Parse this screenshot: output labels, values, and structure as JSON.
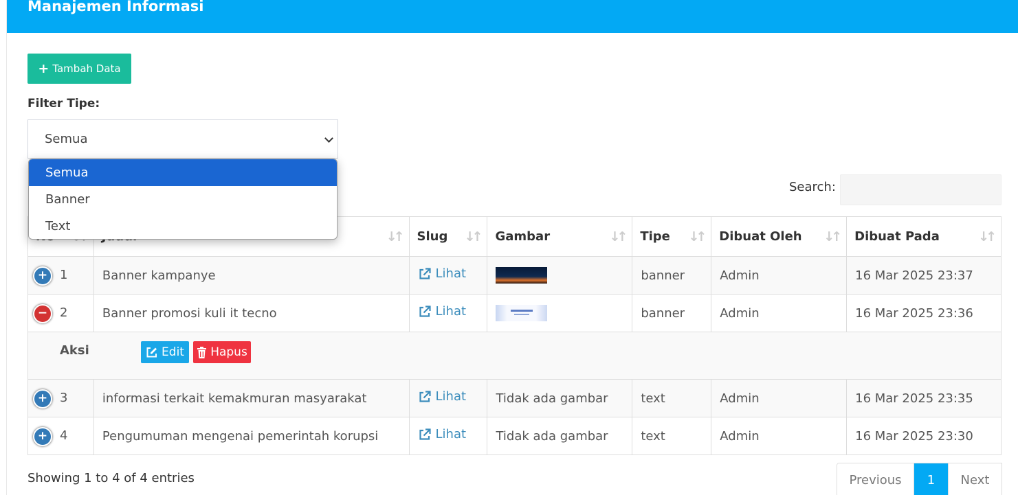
{
  "header": {
    "title": "Manajemen Informasi"
  },
  "toolbar": {
    "add_label": "Tambah Data",
    "add_icon": "plus-icon"
  },
  "filter": {
    "label": "Filter Tipe:",
    "selected": "Semua",
    "options": [
      "Semua",
      "Banner",
      "Text"
    ]
  },
  "search": {
    "label": "Search:",
    "value": ""
  },
  "table": {
    "columns": [
      "No",
      "Judul",
      "Slug",
      "Gambar",
      "Tipe",
      "Dibuat Oleh",
      "Dibuat Pada"
    ],
    "rows": [
      {
        "no": "1",
        "judul": "Banner kampanye",
        "slug": "Lihat",
        "gambar": "",
        "tipe": "banner",
        "dibuat_oleh": "Admin",
        "dibuat_pada": "16 Mar 2025 23:37"
      },
      {
        "no": "2",
        "judul": "Banner promosi kuli it tecno",
        "slug": "Lihat",
        "gambar": "",
        "tipe": "banner",
        "dibuat_oleh": "Admin",
        "dibuat_pada": "16 Mar 2025 23:36"
      },
      {
        "no": "3",
        "judul": "informasi terkait kemakmuran masyarakat",
        "slug": "Lihat",
        "gambar": "Tidak ada gambar",
        "tipe": "text",
        "dibuat_oleh": "Admin",
        "dibuat_pada": "16 Mar 2025 23:35"
      },
      {
        "no": "4",
        "judul": "Pengumuman mengenai pemerintah korupsi",
        "slug": "Lihat",
        "gambar": "Tidak ada gambar",
        "tipe": "text",
        "dibuat_oleh": "Admin",
        "dibuat_pada": "16 Mar 2025 23:30"
      }
    ],
    "child_row": {
      "label": "Aksi",
      "edit_label": "Edit",
      "delete_label": "Hapus"
    }
  },
  "info": {
    "text": "Showing 1 to 4 of 4 entries"
  },
  "pagination": {
    "previous": "Previous",
    "current": "1",
    "next": "Next"
  },
  "colors": {
    "header": "#03a9f4",
    "add_button": "#1abc9c",
    "edit_button": "#1aa7e8",
    "delete_button": "#ef3340",
    "link": "#3c8dbc",
    "selected_option": "#1a66d2"
  }
}
